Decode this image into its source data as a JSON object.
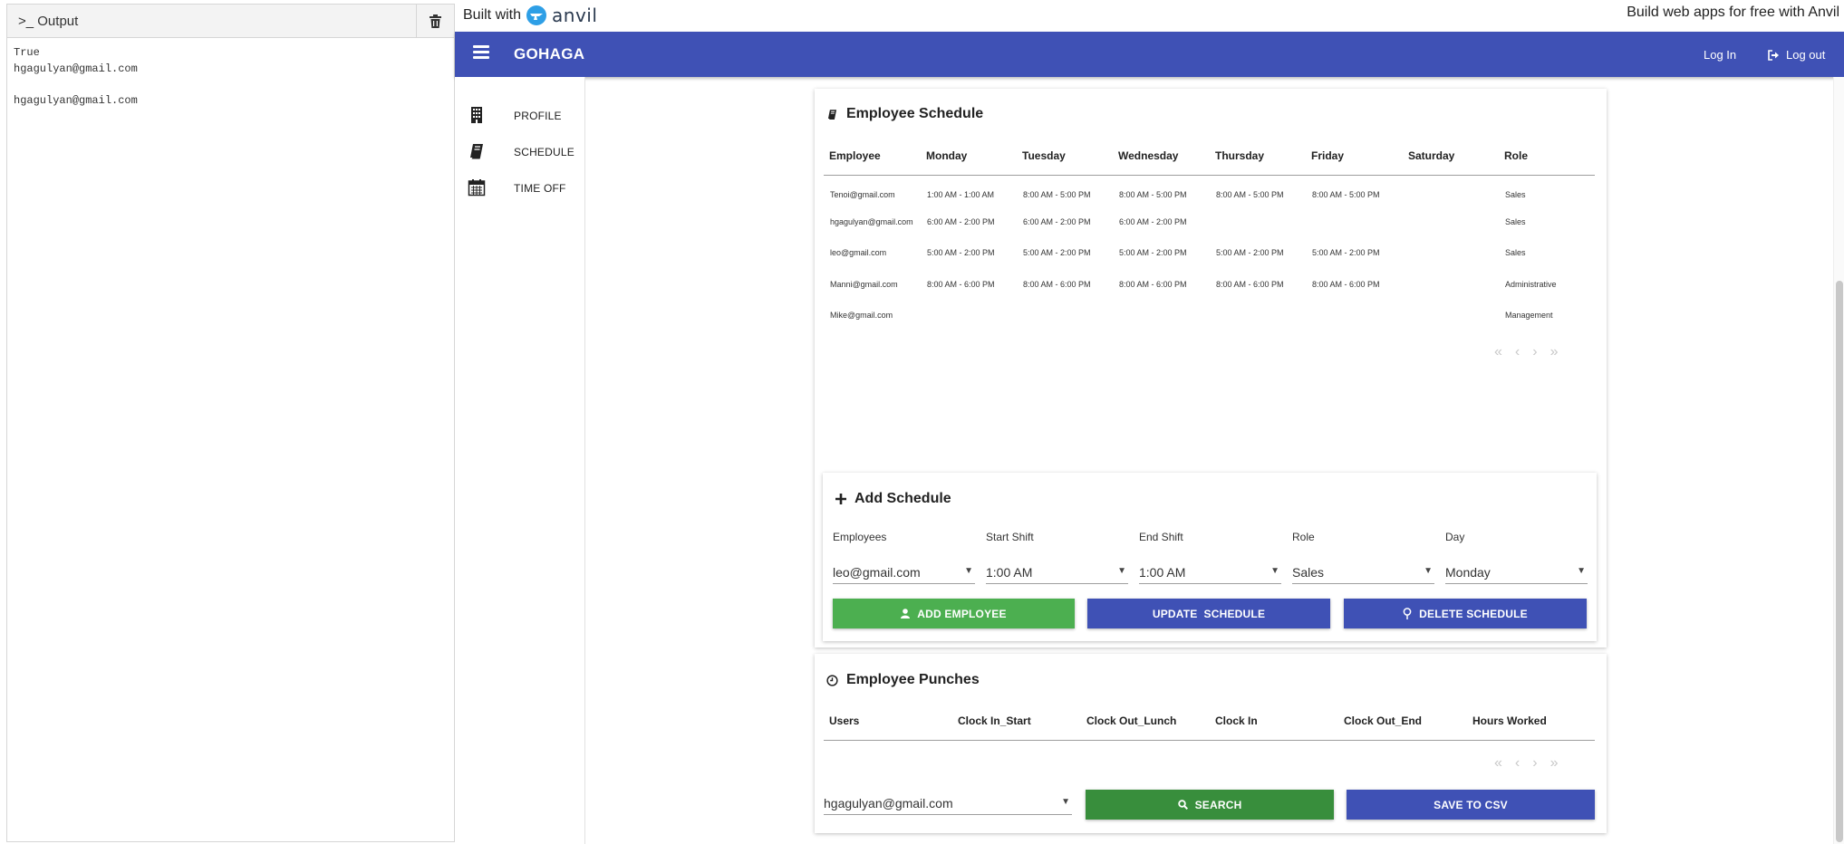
{
  "output": {
    "title": ">_ Output",
    "lines": [
      "True",
      "hgagulyan@gmail.com",
      "",
      "hgagulyan@gmail.com"
    ]
  },
  "anvil": {
    "built_with": "Built with",
    "logo_text": "anvil",
    "build_free": "Build web apps for free with Anvil"
  },
  "app_bar": {
    "title": "GOHAGA",
    "login": "Log In",
    "logout": "Log out",
    "color": "#3f51b5"
  },
  "nav": {
    "items": [
      {
        "label": "PROFILE",
        "icon": "building-icon"
      },
      {
        "label": "SCHEDULE",
        "icon": "book-icon"
      },
      {
        "label": "TIME OFF",
        "icon": "calendar-icon"
      }
    ]
  },
  "schedule": {
    "title": "Employee Schedule",
    "columns": [
      "Employee",
      "Monday",
      "Tuesday",
      "Wednesday",
      "Thursday",
      "Friday",
      "Saturday",
      "Role"
    ],
    "rows": [
      [
        "Tenoi@gmail.com",
        "1:00 AM - 1:00 AM",
        "8:00 AM - 5:00 PM",
        "8:00 AM - 5:00 PM",
        "8:00 AM - 5:00 PM",
        "8:00 AM - 5:00 PM",
        "",
        "Sales"
      ],
      [
        "hgagulyan@gmail.com",
        "6:00 AM - 2:00 PM",
        "6:00 AM - 2:00 PM",
        "6:00 AM - 2:00 PM",
        "",
        "",
        "",
        "Sales"
      ],
      [
        "leo@gmail.com",
        "5:00 AM - 2:00 PM",
        "5:00 AM - 2:00 PM",
        "5:00 AM - 2:00 PM",
        "5:00 AM - 2:00 PM",
        "5:00 AM - 2:00 PM",
        "",
        "Sales"
      ],
      [
        "Manni@gmail.com",
        "8:00 AM - 6:00 PM",
        "8:00 AM - 6:00 PM",
        "8:00 AM - 6:00 PM",
        "8:00 AM - 6:00 PM",
        "8:00 AM - 6:00 PM",
        "",
        "Administrative"
      ],
      [
        "Mike@gmail.com",
        "",
        "",
        "",
        "",
        "",
        "",
        "Management"
      ]
    ]
  },
  "add_schedule": {
    "title": "Add Schedule",
    "fields": [
      {
        "label": "Employees",
        "value": "leo@gmail.com"
      },
      {
        "label": "Start Shift",
        "value": "1:00 AM"
      },
      {
        "label": "End Shift",
        "value": "1:00 AM"
      },
      {
        "label": "Role",
        "value": "Sales"
      },
      {
        "label": "Day",
        "value": "Monday"
      }
    ],
    "add_button": "ADD EMPLOYEE",
    "update_button": "UPDATE  SCHEDULE",
    "delete_button": "DELETE SCHEDULE",
    "green": "#4caf50"
  },
  "punches": {
    "title": "Employee Punches",
    "columns": [
      "Users",
      "Clock In_Start",
      "Clock Out_Lunch",
      "Clock In",
      "Clock Out_End",
      "Hours Worked"
    ],
    "user_select": "hgagulyan@gmail.com",
    "search_button": "SEARCH",
    "save_button": "SAVE TO CSV"
  }
}
